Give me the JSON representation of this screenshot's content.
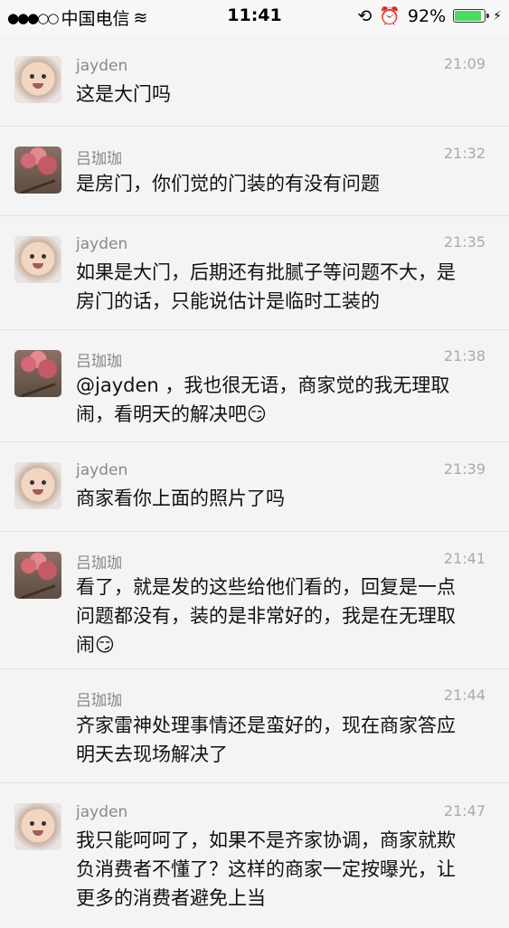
{
  "status_bar": {
    "signal": "●●●○○",
    "carrier": "中国电信",
    "wifi": "≋",
    "time": "11:41",
    "lock": "⟲",
    "alarm": "⏰",
    "battery_percent": "92%",
    "battery_level": 0.92,
    "charging": "⚡"
  },
  "messages": [
    {
      "name": "jayden",
      "time": "21:09",
      "avatar": "baby",
      "text": "这是大门吗"
    },
    {
      "name": "吕珈珈",
      "time": "21:32",
      "avatar": "tree",
      "text": "是房门，你们觉的门装的有没有问题"
    },
    {
      "name": "jayden",
      "time": "21:35",
      "avatar": "baby",
      "text": "如果是大门，后期还有批腻子等问题不大，是房门的话，只能说估计是临时工装的"
    },
    {
      "name": "吕珈珈",
      "time": "21:38",
      "avatar": "tree",
      "text": "@jayden ，我也很无语，商家觉的我无理取闹，看明天的解决吧😏"
    },
    {
      "name": "jayden",
      "time": "21:39",
      "avatar": "baby",
      "text": "商家看你上面的照片了吗"
    },
    {
      "name": "吕珈珈",
      "time": "21:41",
      "avatar": "tree",
      "text": "看了，就是发的这些给他们看的，回复是一点问题都没有，装的是非常好的，我是在无理取闹😏"
    },
    {
      "name": "吕珈珈",
      "time": "21:44",
      "avatar": "none",
      "text": "齐家雷神处理事情还是蛮好的，现在商家答应明天去现场解决了"
    },
    {
      "name": "jayden",
      "time": "21:47",
      "avatar": "baby",
      "text": "我只能呵呵了，如果不是齐家协调，商家就欺负消费者不懂了？这样的商家一定按曝光，让更多的消费者避免上当"
    }
  ]
}
